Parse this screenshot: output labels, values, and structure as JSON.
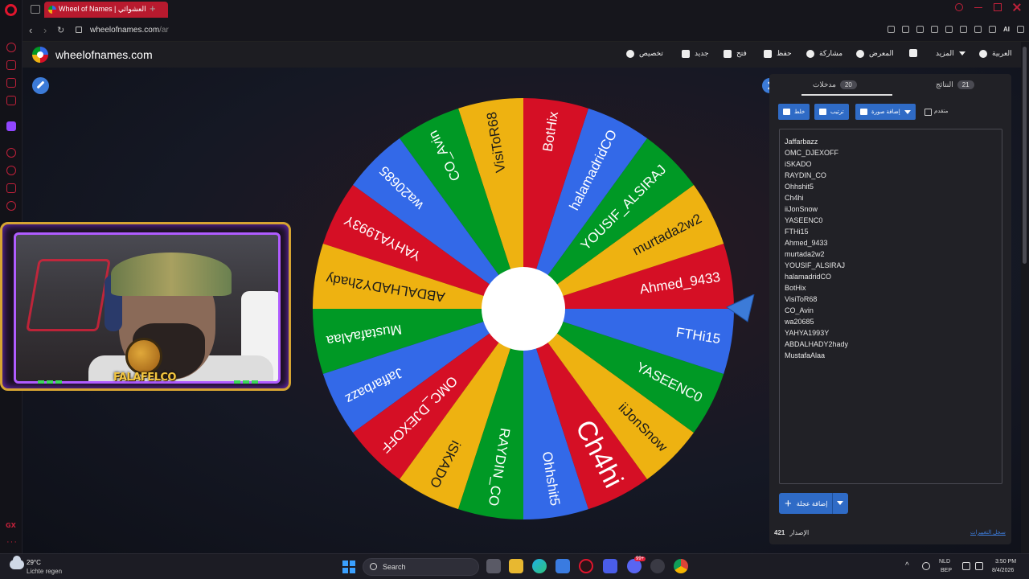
{
  "browser": {
    "tab_title": "Wheel of Names | العشوائي",
    "tab_add": "+",
    "url_host": "wheelofnames.com",
    "url_path": "/ar",
    "ai_label": "AI"
  },
  "side_labels": {
    "gx": "GX",
    "more": "···"
  },
  "site": {
    "name": "wheelofnames.com",
    "menu": {
      "language": "العربية",
      "more": "المزيد",
      "gallery": "المعرض",
      "share": "مشاركة",
      "save": "حفظ",
      "open": "فتح",
      "new": "جديد",
      "customize": "تخصيص"
    }
  },
  "wheel": {
    "segments": [
      "Ahmed_9433",
      "murtada2w2",
      "YOUSIF_ALSIRAJ",
      "halamadridCO",
      "BotHix",
      "VisiToR68",
      "CO_Avin",
      "wa20685",
      "YAHYA1993Y",
      "ABDALHADY2hady",
      "MustafaAlaa",
      "Jaffarbazz",
      "OMC_DJEXOFF",
      "iSKADO",
      "RAYDIN_CO",
      "Ohhshit5",
      "Ch4hi",
      "iiJonSnow",
      "YASEENC0",
      "FTHi15"
    ],
    "colors": [
      "#d50f25",
      "#eeb211",
      "#009925",
      "#3369e8"
    ]
  },
  "webcam": {
    "logo_text": "FALAFELCO"
  },
  "panel": {
    "tab_entries": {
      "label": "مدخلات",
      "count": "20"
    },
    "tab_results": {
      "label": "النتائج",
      "count": "21"
    },
    "shuffle": "خلط",
    "sort": "ترتيب",
    "add_image": "إضافة صورة",
    "advanced": "متقدم",
    "entries": [
      "Jaffarbazz",
      "OMC_DJEXOFF",
      "iSKADO",
      "RAYDIN_CO",
      "Ohhshit5",
      "Ch4hi",
      "iiJonSnow",
      "YASEENC0",
      "FTHi15",
      "Ahmed_9433",
      "murtada2w2",
      "YOUSIF_ALSIRAJ",
      "halamadridCO",
      "BotHix",
      "VisiToR68",
      "CO_Avin",
      "wa20685",
      "YAHYA1993Y",
      "ABDALHADY2hady",
      "MustafaAlaa"
    ],
    "add_wheel": "إضافة عجلة",
    "version_label": "الإصدار",
    "version_number": "421",
    "changelog": "سجل التغييرات"
  },
  "taskbar": {
    "temperature": "29°C",
    "weather": "Lichte regen",
    "search": "Search",
    "lang_top": "NLD",
    "lang_bottom": "BEP",
    "time": "3:50 PM",
    "date": "8/4/2026",
    "chat_badge": "99+"
  }
}
